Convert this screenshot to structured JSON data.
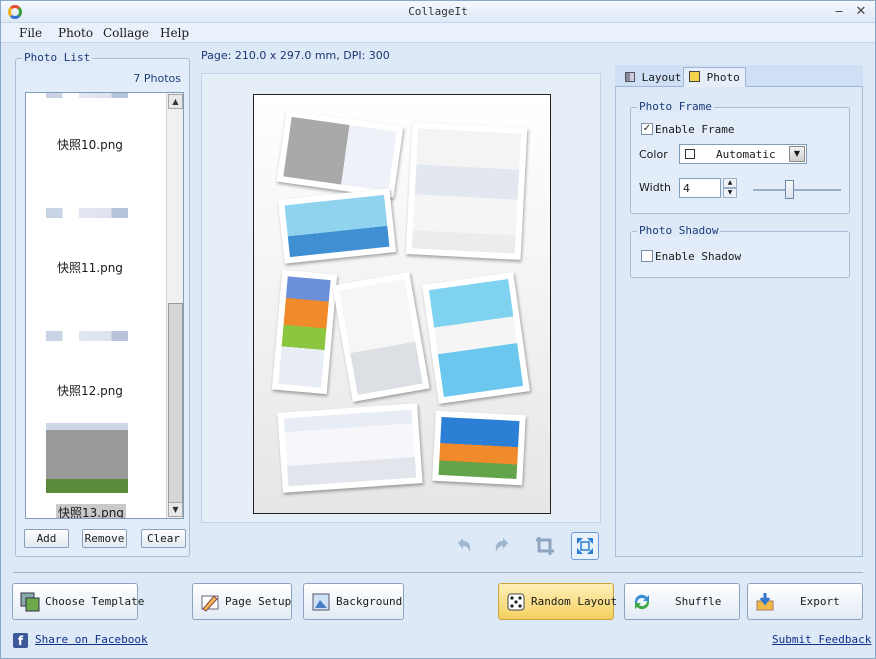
{
  "window": {
    "title": "CollageIt"
  },
  "menu": [
    "File",
    "Photo",
    "Collage",
    "Help"
  ],
  "photo_list": {
    "group_label": "Photo List",
    "count": "7 Photos",
    "items": [
      {
        "label": "快照10.png"
      },
      {
        "label": "快照11.png"
      },
      {
        "label": "快照12.png"
      },
      {
        "label": "快照13.png"
      }
    ],
    "buttons": {
      "add": "Add",
      "remove": "Remove",
      "clear": "Clear"
    }
  },
  "page_info": "Page: 210.0 x 297.0 mm, DPI: 300",
  "tabs": {
    "layout": "Layout",
    "photo": "Photo"
  },
  "photo_frame": {
    "group_label": "Photo Frame",
    "enable_label": "Enable Frame",
    "enabled": true,
    "color_label": "Color",
    "color_value": "Automatic",
    "width_label": "Width",
    "width_value": "4"
  },
  "photo_shadow": {
    "group_label": "Photo Shadow",
    "enable_label": "Enable Shadow",
    "enabled": false
  },
  "bottom": {
    "choose_template": "Choose Template",
    "page_setup": "Page Setup",
    "background": "Background",
    "random_layout": "Random Layout",
    "shuffle": "Shuffle",
    "export": "Export",
    "share": "Share on Facebook",
    "feedback": "Submit Feedback"
  },
  "colors": {
    "accent": "#f7d76c",
    "window_bg": "#dde9f7",
    "link": "#0f2f88",
    "facebook": "#3b5998"
  }
}
